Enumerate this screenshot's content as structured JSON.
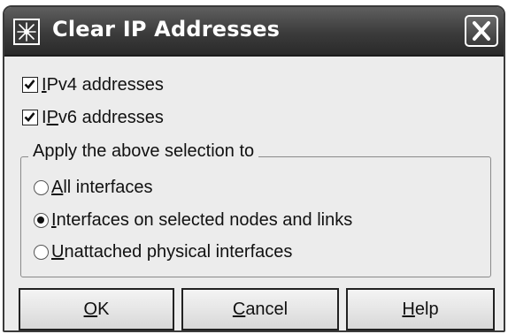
{
  "window": {
    "title": "Clear IP Addresses"
  },
  "options": {
    "ipv4": {
      "label_mnemonic": "I",
      "label_rest": "Pv4 addresses",
      "checked": true
    },
    "ipv6": {
      "label_prefix": "I",
      "label_mnemonic": "P",
      "label_rest": "v6 addresses",
      "checked": true
    }
  },
  "apply_group": {
    "legend": "Apply the above selection to",
    "radios": [
      {
        "label_mnemonic": "A",
        "label_rest": "ll interfaces",
        "selected": false
      },
      {
        "label_mnemonic": "I",
        "label_rest": "nterfaces on selected nodes and links",
        "selected": true
      },
      {
        "label_mnemonic": "U",
        "label_rest": "nattached physical interfaces",
        "selected": false
      }
    ]
  },
  "buttons": {
    "ok": {
      "mnemonic": "O",
      "rest": "K"
    },
    "cancel": {
      "mnemonic": "C",
      "rest": "ancel"
    },
    "help": {
      "mnemonic": "H",
      "rest": "elp"
    }
  },
  "icons": {
    "app": "network-star-icon",
    "close": "close-x-icon"
  }
}
